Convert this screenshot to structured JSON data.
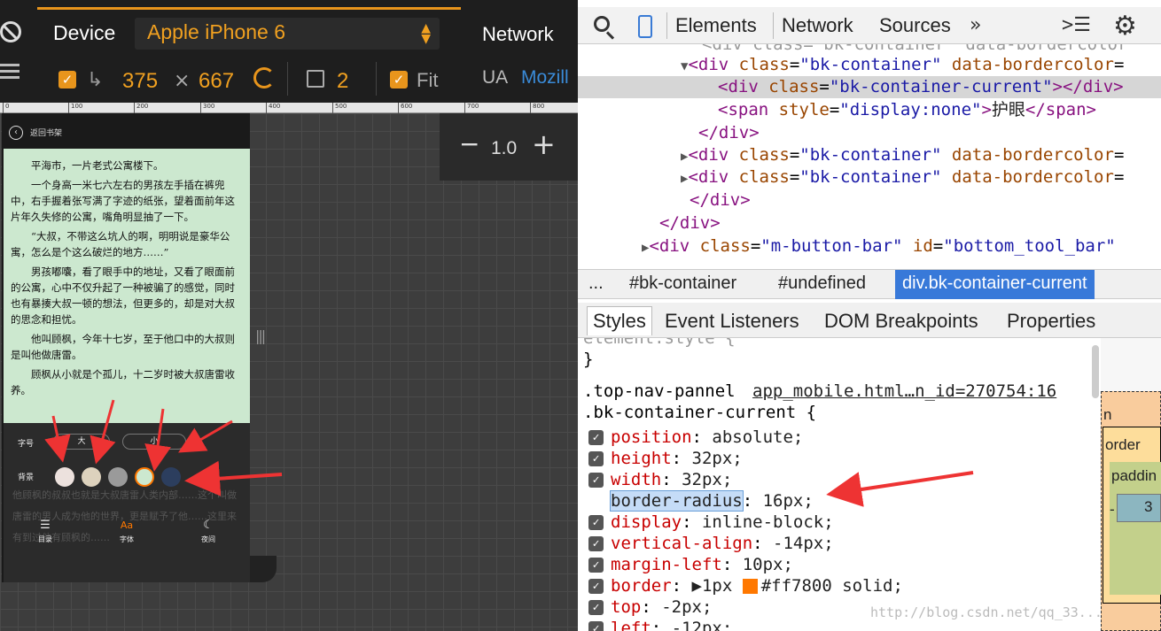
{
  "emulation": {
    "device_label": "Device",
    "device_value": "Apple iPhone 6",
    "width": "375",
    "times": "×",
    "height": "667",
    "scale": "2",
    "fit_label": "Fit",
    "network_label": "Network",
    "ua_label": "UA",
    "ua_value": "Mozill",
    "ruler_ticks": [
      "0",
      "100",
      "200",
      "300",
      "400",
      "500",
      "600",
      "700",
      "800"
    ],
    "zoom_minus": "−",
    "zoom_value": "1.0",
    "zoom_plus": "+"
  },
  "phone": {
    "back_text": "返回书架",
    "paragraphs": [
      "平海市，一片老式公寓楼下。",
      "一个身高一米七六左右的男孩左手插在裤兜中，右手握着张写满了字迹的纸张，望着面前年这片年久失修的公寓，嘴角明显抽了一下。",
      "“大叔，不带这么坑人的啊，明明说是豪华公寓，怎么是个这么破烂的地方……”",
      "男孩嘟囔，看了眼手中的地址，又看了眼面前的公寓，心中不仅升起了一种被骗了的感觉，同时也有暴揍大叔一顿的想法，但更多的，却是对大叔的思念和担忧。",
      "他叫顾枫，今年十七岁，至于他口中的大叔则是叫他做唐雷。",
      "顾枫从小就是个孤儿，十二岁时被大叔唐雷收养。"
    ],
    "under_text": "他顾枫的叔叔也就是大叔唐雷人类内部……这个叫做唐雷的男人成为他的世界，更是赋予了他……这里来有到过他有顾枫的……",
    "font_label": "字号",
    "font_big": "大",
    "font_small": "小",
    "bg_label": "背景",
    "bg_colors": [
      "#ece1dd",
      "#ddd2bd",
      "#9a9a9a",
      "#cce8cf",
      "#2c3e5e"
    ],
    "menu": [
      {
        "icon": "☰",
        "label": "目录"
      },
      {
        "icon": "Aa",
        "label": "字体"
      },
      {
        "icon": "☾",
        "label": "夜间"
      }
    ],
    "bottom_bars": "☰",
    "side_handle": "|||"
  },
  "devtools": {
    "tabs": [
      "Elements",
      "Network",
      "Sources"
    ],
    "more": "»",
    "dom": [
      {
        "indent": 0,
        "tri": "",
        "html": "div class=\"bk-container\" data-bordercolor"
      },
      {
        "indent": 1,
        "tri": "▼",
        "tag_open": "<div ",
        "attr": "class",
        "val": "\"bk-container\"",
        "attr2": "data-bordercolor",
        "rest": "="
      },
      {
        "indent": 2,
        "tri": "",
        "line": "<div class=\"bk-container-current\"></div>"
      },
      {
        "indent": 2,
        "tri": "",
        "line": "<span style=\"display:none\">护眼</span>"
      },
      {
        "indent": 1,
        "tri": "",
        "line": "</div>"
      },
      {
        "indent": 1,
        "tri": "▶",
        "line": "<div class=\"bk-container\" data-bordercolor="
      },
      {
        "indent": 1,
        "tri": "▶",
        "line": "<div class=\"bk-container\" data-bordercolor="
      },
      {
        "indent": 1,
        "tri": "",
        "line": "</div>"
      },
      {
        "indent": 0,
        "tri": "",
        "line": "</div>"
      },
      {
        "indent": 0,
        "tri": "▶",
        "line": "<div class=\"m-button-bar\" id=\"bottom_tool_bar\""
      }
    ],
    "breadcrumbs": [
      "...",
      "#bk-container",
      "#undefined",
      "div.bk-container-current"
    ],
    "side_tabs": [
      "Styles",
      "Event Listeners",
      "DOM Breakpoints",
      "Properties"
    ],
    "styles": {
      "element_style": "element.style {",
      "close_brace": "}",
      "selector1": ".top-nav-pannel",
      "source": "app_mobile.html…n_id=270754:16",
      "selector2": ".bk-container-current {",
      "props": [
        {
          "name": "position",
          "value": "absolute;"
        },
        {
          "name": "height",
          "value": "32px;"
        },
        {
          "name": "width",
          "value": "32px;"
        },
        {
          "name": "border-radius",
          "value": "16px;",
          "editing": true
        },
        {
          "name": "display",
          "value": "inline-block;"
        },
        {
          "name": "vertical-align",
          "value": "-14px;"
        },
        {
          "name": "margin-left",
          "value": "10px;"
        },
        {
          "name": "border",
          "value": "1px #ff7800 solid;"
        },
        {
          "name": "top",
          "value": "-2px;"
        },
        {
          "name": "left",
          "value": "-12px;"
        }
      ]
    },
    "boxmodel": {
      "margin_label": "n",
      "border_label": "order",
      "padding_label": "paddin",
      "dash": "-",
      "content": "3"
    },
    "watermark": "http://blog.csdn.net/qq_33..."
  },
  "colors": {
    "accent_orange": "#e8951c",
    "selected_blue": "#3879d9",
    "annotation_red": "#ee3333"
  }
}
